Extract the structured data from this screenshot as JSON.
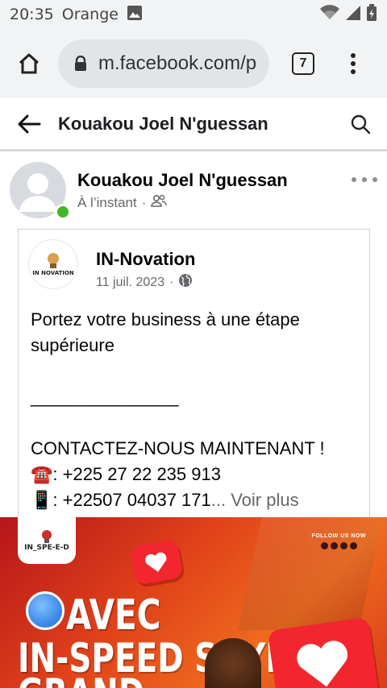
{
  "status_bar": {
    "time": "20:35",
    "carrier": "Orange"
  },
  "browser": {
    "url": "m.facebook.com/p",
    "tab_count": "7"
  },
  "header": {
    "title": "Kouakou Joel N'guessan"
  },
  "post": {
    "author": "Kouakou Joel N'guessan",
    "time": "À l’instant",
    "separator": "·",
    "shared": {
      "page_name": "IN-Novation",
      "logo_text": "IN NOVATION",
      "date": "11 juil. 2023",
      "separator": "·",
      "lines": [
        "Portez votre business à une étape supérieure",
        "",
        "_______________",
        "",
        "CONTACTEZ-NOUS MAINTENANT !",
        "☎️: +225 27 22 235 913"
      ],
      "last_line": "📱: +22507 04037 171",
      "see_more": "... Voir plus"
    },
    "banner": {
      "logo_text": "IN_SPE-E-D",
      "follow_text": "FOLLOW US NOW",
      "line1": "AVEC",
      "line2": "IN-SPEED SOYEZ",
      "line3": "GRAND"
    }
  },
  "colors": {
    "online": "#42b72a",
    "meta_text": "#65676b",
    "heart_red": "#f3262f"
  }
}
